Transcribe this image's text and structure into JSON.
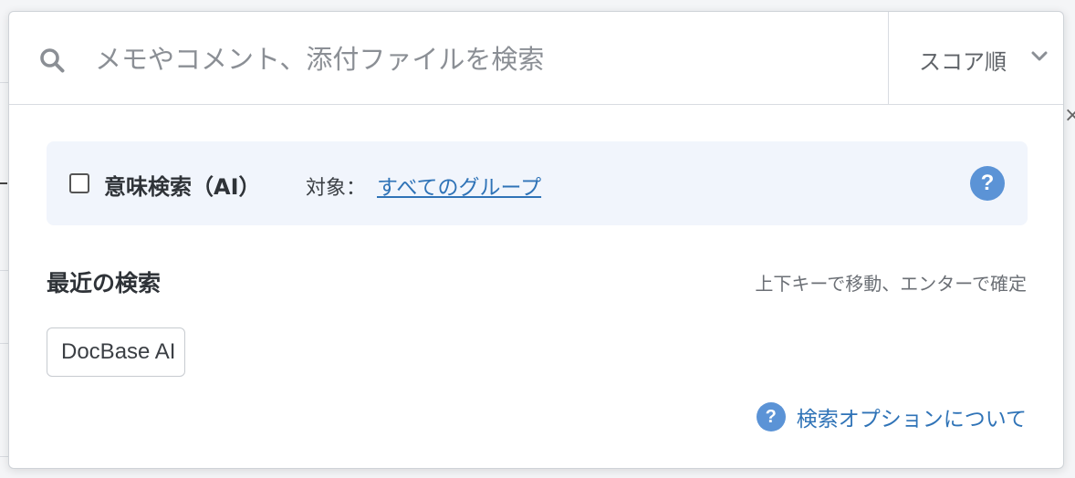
{
  "search": {
    "placeholder": "メモやコメント、添付ファイルを検索",
    "value": ""
  },
  "sort": {
    "selected": "スコア順"
  },
  "ai_search": {
    "checkbox_label": "意味検索（AI）",
    "checked": false,
    "target_label": "対象：",
    "target_link": "すべてのグループ",
    "help_glyph": "?"
  },
  "recent": {
    "title": "最近の検索",
    "hint": "上下キーで移動、エンターで確定",
    "items": [
      "DocBase AI"
    ]
  },
  "footer": {
    "help_glyph": "?",
    "options_link": "検索オプションについて"
  },
  "colors": {
    "accent": "#2f73b7",
    "help_icon_bg": "#5b93d6",
    "ai_box_bg": "#f1f5fc"
  },
  "icons": {
    "search": "search-icon",
    "chevron": "chevron-down-icon",
    "help": "question-circle-icon"
  }
}
